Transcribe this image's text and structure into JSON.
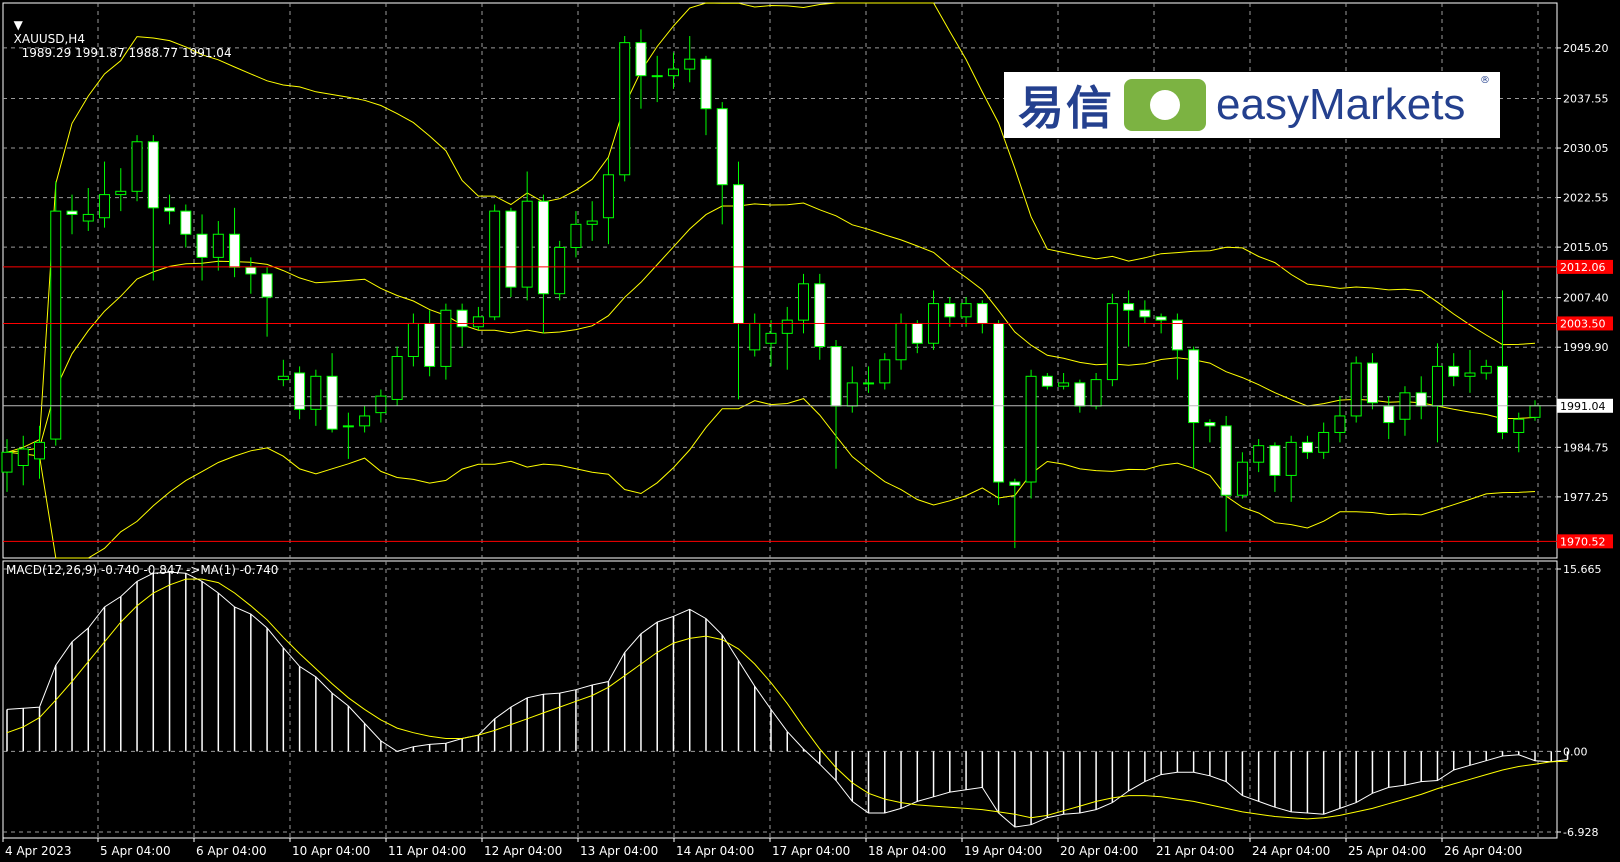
{
  "header": {
    "symbol_text": "XAUUSD,H4",
    "ohlc_text": "1989.29 1991.87 1988.77 1991.04"
  },
  "macd_header": {
    "label": "MACD(12,26,9) -0.740 -0.847 ->MA(1) -0.740"
  },
  "logo": {
    "cn_text": "易信",
    "en_text": "easyMarkets",
    "reg_mark": "®"
  },
  "colors": {
    "background": "#000000",
    "grid": "#9a9a9a",
    "bull_candle": "#00ff00",
    "bear_candle": "#ffffff",
    "bands": "#ffff00",
    "level_line": "#ff0000",
    "macd_hist": "#ffffff",
    "macd_signal": "#ffff00",
    "logo_blue": "#24408e",
    "logo_green": "#7cb342"
  },
  "price_axis": {
    "ticks": [
      "2045.20",
      "2037.55",
      "2030.05",
      "2022.55",
      "2015.05",
      "2007.40",
      "1999.90",
      "1992.40",
      "1984.75",
      "1977.25"
    ],
    "current_price": "1991.04",
    "level_labels": [
      "2012.06",
      "2003.50",
      "1970.52"
    ]
  },
  "macd_axis": {
    "ticks": [
      "15.665",
      "0.00",
      "-6.928"
    ]
  },
  "time_axis": {
    "labels": [
      "4 Apr 2023",
      "5 Apr 04:00",
      "6 Apr 04:00",
      "10 Apr 04:00",
      "11 Apr 04:00",
      "12 Apr 04:00",
      "13 Apr 04:00",
      "14 Apr 04:00",
      "17 Apr 04:00",
      "18 Apr 04:00",
      "19 Apr 04:00",
      "20 Apr 04:00",
      "21 Apr 04:00",
      "24 Apr 04:00",
      "25 Apr 04:00",
      "26 Apr 04:00"
    ]
  },
  "chart_data": {
    "type": "candlestick",
    "symbol": "XAUUSD",
    "timeframe": "H4",
    "ylim": [
      1968,
      2052
    ],
    "levels": [
      2012.06,
      2003.5,
      1970.52
    ],
    "candles": [
      {
        "o": 1981.0,
        "c": 1984.0,
        "h": 1986.0,
        "l": 1978.0
      },
      {
        "o": 1982.0,
        "c": 1984.5,
        "h": 1986.5,
        "l": 1979.0
      },
      {
        "o": 1983.0,
        "c": 1985.5,
        "h": 1988.0,
        "l": 1980.0
      },
      {
        "o": 1986.0,
        "c": 2020.5,
        "h": 2025.0,
        "l": 1985.0
      },
      {
        "o": 2020.5,
        "c": 2020.0,
        "h": 2023.0,
        "l": 2017.0
      },
      {
        "o": 2019.0,
        "c": 2020.0,
        "h": 2024.0,
        "l": 2017.5
      },
      {
        "o": 2019.5,
        "c": 2023.0,
        "h": 2028.0,
        "l": 2018.0
      },
      {
        "o": 2023.0,
        "c": 2023.5,
        "h": 2027.0,
        "l": 2020.5
      },
      {
        "o": 2023.5,
        "c": 2031.0,
        "h": 2032.0,
        "l": 2022.0
      },
      {
        "o": 2031.0,
        "c": 2021.0,
        "h": 2032.0,
        "l": 2010.0
      },
      {
        "o": 2021.0,
        "c": 2020.5,
        "h": 2023.0,
        "l": 2018.5
      },
      {
        "o": 2020.5,
        "c": 2017.0,
        "h": 2021.5,
        "l": 2015.0
      },
      {
        "o": 2017.0,
        "c": 2013.5,
        "h": 2020.0,
        "l": 2010.0
      },
      {
        "o": 2013.5,
        "c": 2017.0,
        "h": 2019.0,
        "l": 2011.5
      },
      {
        "o": 2017.0,
        "c": 2012.0,
        "h": 2021.0,
        "l": 2010.5
      },
      {
        "o": 2012.0,
        "c": 2011.0,
        "h": 2013.5,
        "l": 2008.0
      },
      {
        "o": 2011.0,
        "c": 2007.5,
        "h": 2012.0,
        "l": 2001.5
      },
      {
        "o": 1995.0,
        "c": 1995.5,
        "h": 1998.0,
        "l": 1994.0
      },
      {
        "o": 1996.0,
        "c": 1990.5,
        "h": 1997.0,
        "l": 1989.0
      },
      {
        "o": 1990.5,
        "c": 1995.5,
        "h": 1996.5,
        "l": 1988.0
      },
      {
        "o": 1995.5,
        "c": 1987.5,
        "h": 1999.0,
        "l": 1987.0
      },
      {
        "o": 1988.0,
        "c": 1988.0,
        "h": 1990.0,
        "l": 1983.0
      },
      {
        "o": 1988.0,
        "c": 1989.5,
        "h": 1991.0,
        "l": 1987.0
      },
      {
        "o": 1990.0,
        "c": 1992.5,
        "h": 1993.5,
        "l": 1988.5
      },
      {
        "o": 1992.0,
        "c": 1998.5,
        "h": 2000.0,
        "l": 1991.0
      },
      {
        "o": 1998.5,
        "c": 2003.5,
        "h": 2005.0,
        "l": 1997.0
      },
      {
        "o": 2003.5,
        "c": 1997.0,
        "h": 2005.5,
        "l": 1995.5
      },
      {
        "o": 1997.0,
        "c": 2005.5,
        "h": 2006.5,
        "l": 1995.0
      },
      {
        "o": 2005.5,
        "c": 2003.0,
        "h": 2006.5,
        "l": 2000.0
      },
      {
        "o": 2003.0,
        "c": 2004.5,
        "h": 2006.0,
        "l": 2002.5
      },
      {
        "o": 2004.5,
        "c": 2020.5,
        "h": 2021.5,
        "l": 2004.0
      },
      {
        "o": 2020.5,
        "c": 2009.0,
        "h": 2021.0,
        "l": 2007.5
      },
      {
        "o": 2009.0,
        "c": 2022.0,
        "h": 2026.5,
        "l": 2007.0
      },
      {
        "o": 2022.0,
        "c": 2008.0,
        "h": 2023.0,
        "l": 2002.0
      },
      {
        "o": 2008.0,
        "c": 2015.0,
        "h": 2016.0,
        "l": 2007.0
      },
      {
        "o": 2015.0,
        "c": 2018.5,
        "h": 2020.5,
        "l": 2013.5
      },
      {
        "o": 2018.5,
        "c": 2019.0,
        "h": 2022.0,
        "l": 2016.0
      },
      {
        "o": 2019.5,
        "c": 2026.0,
        "h": 2028.5,
        "l": 2015.5
      },
      {
        "o": 2026.0,
        "c": 2046.0,
        "h": 2047.0,
        "l": 2025.0
      },
      {
        "o": 2046.0,
        "c": 2041.0,
        "h": 2048.0,
        "l": 2036.0
      },
      {
        "o": 2041.0,
        "c": 2041.0,
        "h": 2044.0,
        "l": 2037.0
      },
      {
        "o": 2041.0,
        "c": 2042.0,
        "h": 2044.5,
        "l": 2039.0
      },
      {
        "o": 2042.0,
        "c": 2043.5,
        "h": 2047.0,
        "l": 2040.0
      },
      {
        "o": 2043.5,
        "c": 2036.0,
        "h": 2044.0,
        "l": 2032.0
      },
      {
        "o": 2036.0,
        "c": 2024.5,
        "h": 2037.0,
        "l": 2018.5
      },
      {
        "o": 2024.5,
        "c": 2003.5,
        "h": 2028.0,
        "l": 1992.0
      },
      {
        "o": 1999.5,
        "c": 2003.5,
        "h": 2005.0,
        "l": 1998.5
      },
      {
        "o": 2000.5,
        "c": 2002.0,
        "h": 2004.0,
        "l": 1997.0
      },
      {
        "o": 2002.0,
        "c": 2004.0,
        "h": 2006.0,
        "l": 1996.5
      },
      {
        "o": 2004.0,
        "c": 2009.5,
        "h": 2011.0,
        "l": 2002.0
      },
      {
        "o": 2009.5,
        "c": 2000.0,
        "h": 2011.0,
        "l": 1998.0
      },
      {
        "o": 2000.0,
        "c": 1991.0,
        "h": 2001.0,
        "l": 1981.5
      },
      {
        "o": 1991.0,
        "c": 1994.5,
        "h": 1997.0,
        "l": 1990.0
      },
      {
        "o": 1994.5,
        "c": 1994.5,
        "h": 1997.0,
        "l": 1993.0
      },
      {
        "o": 1994.5,
        "c": 1998.0,
        "h": 1999.0,
        "l": 1993.5
      },
      {
        "o": 1998.0,
        "c": 2003.5,
        "h": 2005.0,
        "l": 1996.5
      },
      {
        "o": 2003.5,
        "c": 2000.5,
        "h": 2004.0,
        "l": 1999.0
      },
      {
        "o": 2000.5,
        "c": 2006.5,
        "h": 2008.5,
        "l": 1999.5
      },
      {
        "o": 2006.5,
        "c": 2004.5,
        "h": 2007.5,
        "l": 2003.0
      },
      {
        "o": 2004.5,
        "c": 2006.5,
        "h": 2007.5,
        "l": 2003.0
      },
      {
        "o": 2006.5,
        "c": 2003.5,
        "h": 2007.0,
        "l": 2002.0
      },
      {
        "o": 2003.5,
        "c": 1979.5,
        "h": 2004.0,
        "l": 1976.0
      },
      {
        "o": 1979.5,
        "c": 1979.0,
        "h": 1980.0,
        "l": 1969.5
      },
      {
        "o": 1979.5,
        "c": 1995.5,
        "h": 1996.5,
        "l": 1977.0
      },
      {
        "o": 1995.5,
        "c": 1994.0,
        "h": 1996.0,
        "l": 1993.5
      },
      {
        "o": 1994.0,
        "c": 1994.5,
        "h": 1996.0,
        "l": 1993.5
      },
      {
        "o": 1994.5,
        "c": 1991.0,
        "h": 1995.0,
        "l": 1990.0
      },
      {
        "o": 1991.0,
        "c": 1995.0,
        "h": 1996.0,
        "l": 1990.5
      },
      {
        "o": 1995.0,
        "c": 2006.5,
        "h": 2008.0,
        "l": 1994.0
      },
      {
        "o": 2006.5,
        "c": 2005.5,
        "h": 2008.5,
        "l": 2000.0
      },
      {
        "o": 2005.5,
        "c": 2004.5,
        "h": 2007.0,
        "l": 2003.5
      },
      {
        "o": 2004.5,
        "c": 2004.0,
        "h": 2005.0,
        "l": 2002.0
      },
      {
        "o": 2004.0,
        "c": 1999.5,
        "h": 2005.0,
        "l": 1995.0
      },
      {
        "o": 1999.5,
        "c": 1988.5,
        "h": 2000.0,
        "l": 1981.5
      },
      {
        "o": 1988.5,
        "c": 1988.0,
        "h": 1989.0,
        "l": 1985.5
      },
      {
        "o": 1988.0,
        "c": 1977.5,
        "h": 1989.5,
        "l": 1972.0
      },
      {
        "o": 1977.5,
        "c": 1982.5,
        "h": 1984.0,
        "l": 1977.0
      },
      {
        "o": 1982.5,
        "c": 1985.0,
        "h": 1986.0,
        "l": 1981.0
      },
      {
        "o": 1985.0,
        "c": 1980.5,
        "h": 1985.5,
        "l": 1978.0
      },
      {
        "o": 1980.5,
        "c": 1985.5,
        "h": 1986.5,
        "l": 1976.5
      },
      {
        "o": 1985.5,
        "c": 1984.0,
        "h": 1986.5,
        "l": 1983.0
      },
      {
        "o": 1984.0,
        "c": 1987.0,
        "h": 1988.5,
        "l": 1983.0
      },
      {
        "o": 1987.0,
        "c": 1989.5,
        "h": 1992.5,
        "l": 1985.5
      },
      {
        "o": 1989.5,
        "c": 1997.5,
        "h": 1998.5,
        "l": 1988.5
      },
      {
        "o": 1997.5,
        "c": 1991.5,
        "h": 1999.0,
        "l": 1990.5
      },
      {
        "o": 1991.0,
        "c": 1988.5,
        "h": 1992.5,
        "l": 1986.0
      },
      {
        "o": 1989.0,
        "c": 1993.0,
        "h": 1994.0,
        "l": 1986.5
      },
      {
        "o": 1993.0,
        "c": 1991.0,
        "h": 1995.5,
        "l": 1989.0
      },
      {
        "o": 1991.0,
        "c": 1997.0,
        "h": 2000.5,
        "l": 1985.5
      },
      {
        "o": 1997.0,
        "c": 1995.5,
        "h": 1999.0,
        "l": 1994.0
      },
      {
        "o": 1995.5,
        "c": 1996.0,
        "h": 1999.5,
        "l": 1993.0
      },
      {
        "o": 1996.0,
        "c": 1997.0,
        "h": 1998.0,
        "l": 1995.0
      },
      {
        "o": 1997.0,
        "c": 1987.0,
        "h": 2008.5,
        "l": 1986.0
      },
      {
        "o": 1987.0,
        "c": 1989.0,
        "h": 1990.0,
        "l": 1984.0
      },
      {
        "o": 1989.29,
        "c": 1991.04,
        "h": 1991.87,
        "l": 1988.77
      }
    ],
    "macd": {
      "ylim": [
        -6.928,
        15.665
      ],
      "hist": [
        3.6,
        3.7,
        3.8,
        7.4,
        9.4,
        10.6,
        12.4,
        13.3,
        14.6,
        15.3,
        15.4,
        15.3,
        14.6,
        13.6,
        12.4,
        11.8,
        10.6,
        8.9,
        7.3,
        6.4,
        5.0,
        3.9,
        2.4,
        0.9,
        0.0,
        0.4,
        0.6,
        0.7,
        1.1,
        1.4,
        2.8,
        3.8,
        4.6,
        4.9,
        5.0,
        5.3,
        5.7,
        6.0,
        8.5,
        10.1,
        11.1,
        11.6,
        12.2,
        11.4,
        10.0,
        7.8,
        5.6,
        3.6,
        1.7,
        0.2,
        -1.1,
        -2.5,
        -4.3,
        -5.3,
        -5.3,
        -4.9,
        -4.3,
        -3.9,
        -3.5,
        -3.3,
        -3.1,
        -5.3,
        -6.5,
        -6.3,
        -5.7,
        -5.4,
        -5.3,
        -5.0,
        -4.4,
        -3.4,
        -2.6,
        -2.0,
        -1.8,
        -1.8,
        -2.1,
        -2.6,
        -3.8,
        -4.3,
        -4.8,
        -5.2,
        -5.3,
        -5.4,
        -4.9,
        -4.4,
        -3.6,
        -3.1,
        -2.9,
        -2.6,
        -2.5,
        -1.6,
        -1.2,
        -0.8,
        -0.4,
        -0.3,
        -0.8,
        -0.9,
        -0.7
      ],
      "signal": [
        1.6,
        2.1,
        2.9,
        4.4,
        6.0,
        7.7,
        9.4,
        11.1,
        12.5,
        13.6,
        14.3,
        14.8,
        14.8,
        14.5,
        13.6,
        12.5,
        11.3,
        9.8,
        8.4,
        7.1,
        5.8,
        4.6,
        3.6,
        2.7,
        2.0,
        1.6,
        1.3,
        1.1,
        1.1,
        1.4,
        1.8,
        2.3,
        2.8,
        3.3,
        3.8,
        4.3,
        4.8,
        5.5,
        6.5,
        7.5,
        8.5,
        9.3,
        9.7,
        9.9,
        9.6,
        8.8,
        7.5,
        5.9,
        4.1,
        2.1,
        0.2,
        -1.4,
        -2.7,
        -3.6,
        -4.1,
        -4.4,
        -4.6,
        -4.7,
        -4.8,
        -4.9,
        -5.0,
        -5.2,
        -5.4,
        -5.7,
        -5.5,
        -5.1,
        -4.7,
        -4.3,
        -4.0,
        -3.8,
        -3.8,
        -3.9,
        -4.1,
        -4.3,
        -4.6,
        -4.9,
        -5.2,
        -5.4,
        -5.6,
        -5.7,
        -5.8,
        -5.7,
        -5.5,
        -5.2,
        -4.9,
        -4.5,
        -4.1,
        -3.7,
        -3.2,
        -2.8,
        -2.4,
        -2.0,
        -1.6,
        -1.3,
        -1.1,
        -0.9,
        -0.85
      ]
    }
  }
}
